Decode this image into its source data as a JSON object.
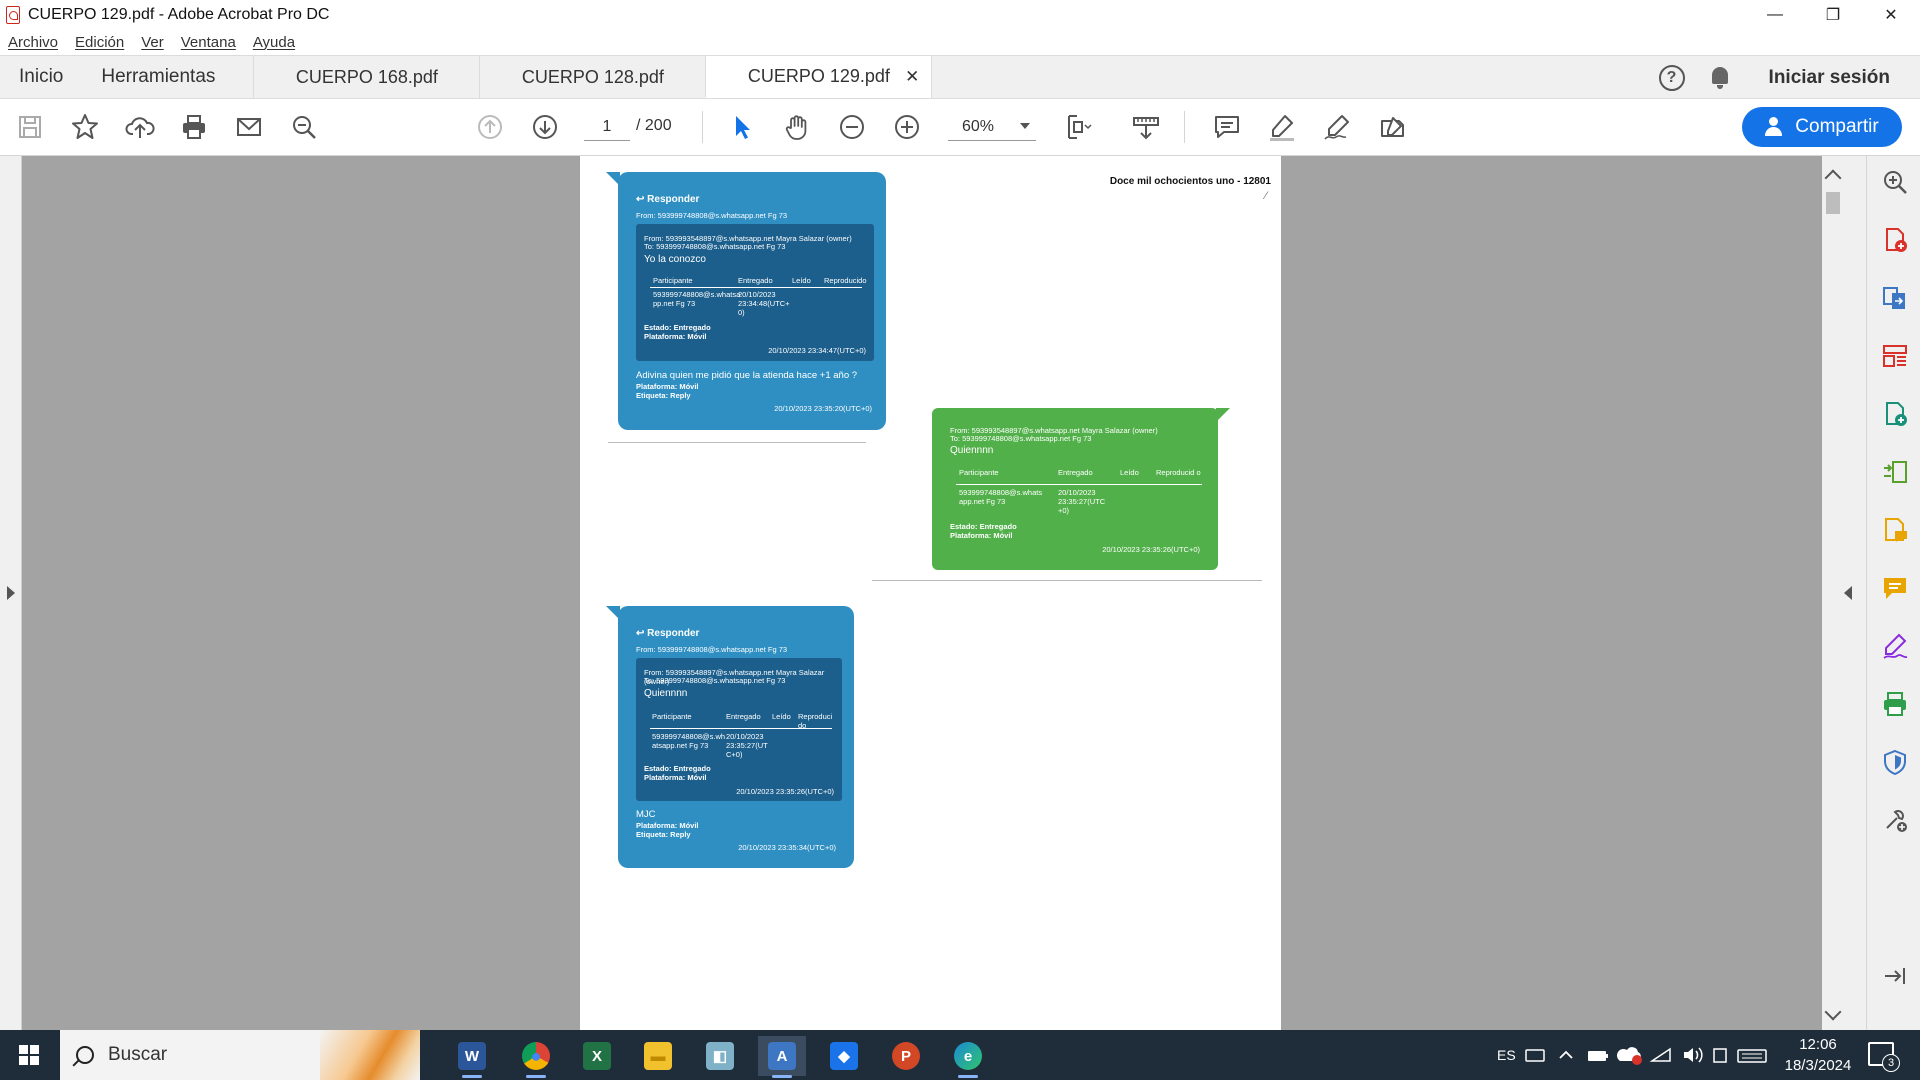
{
  "window": {
    "title": "CUERPO 129.pdf - Adobe Acrobat Pro DC",
    "minimize": "—",
    "restore": "❐",
    "close": "✕"
  },
  "menu": [
    "Archivo",
    "Edición",
    "Ver",
    "Ventana",
    "Ayuda"
  ],
  "tabs": {
    "home": "Inicio",
    "tools": "Herramientas",
    "docs": [
      "CUERPO 168.pdf",
      "CUERPO 128.pdf",
      "CUERPO 129.pdf"
    ],
    "active_doc_index": 2,
    "close_glyph": "✕",
    "help": "?",
    "signin": "Iniciar sesión"
  },
  "toolbar": {
    "page_current": "1",
    "page_total": "/ 200",
    "zoom": "60%",
    "share": "Compartir"
  },
  "document": {
    "header": "Doce mil ochocientos uno - 12801",
    "mark": "⁄",
    "messages": [
      {
        "reply_label": "Responder",
        "reply_glyph": "↩",
        "from": "From: 593999748808@s.whatsapp.net Fg 73",
        "quote_from": "From: 593993548897@s.whatsapp.net Mayra Salazar (owner)",
        "quote_to": "To: 593999748808@s.whatsapp.net Fg 73",
        "quote_msg": "Yo la conozco",
        "table_head": [
          "Participante",
          "Entregado",
          "Leído",
          "Reproducido"
        ],
        "table_row": [
          "593999748808@s.whatsa pp.net Fg 73",
          "20/10/2023 23:34:48(UTC+ 0)"
        ],
        "quote_estado": "Estado: Entregado",
        "quote_plataforma": "Plataforma: Móvil",
        "quote_ts": "20/10/2023 23:34:47(UTC+0)",
        "msg": "Adivina quien me pidió que la atienda hace +1 año ?",
        "plataforma": "Plataforma: Móvil",
        "etiqueta": "Etiqueta: Reply",
        "ts": "20/10/2023 23:35:20(UTC+0)"
      },
      {
        "from": "From: 593993548897@s.whatsapp.net Mayra Salazar (owner)",
        "to": "To: 593999748808@s.whatsapp.net Fg 73",
        "msg": "Quiennnn",
        "table_head": [
          "Participante",
          "Entregado",
          "Leído",
          "Reproducid o"
        ],
        "table_row": [
          "593999748808@s.whats app.net Fg 73",
          "20/10/2023 23:35:27(UTC +0)"
        ],
        "estado": "Estado: Entregado",
        "plataforma": "Plataforma: Móvil",
        "ts": "20/10/2023 23:35:26(UTC+0)"
      },
      {
        "reply_label": "Responder",
        "reply_glyph": "↩",
        "from": "From: 593999748808@s.whatsapp.net Fg 73",
        "quote_from": "From: 593993548897@s.whatsapp.net Mayra Salazar (owner)",
        "quote_to": "To: 593999748808@s.whatsapp.net Fg 73",
        "quote_msg": "Quiennnn",
        "table_head": [
          "Participante",
          "Entregado",
          "Leído",
          "Reproduci do"
        ],
        "table_row": [
          "593999748808@s.wh atsapp.net Fg 73",
          "20/10/2023 23:35:27(UT C+0)"
        ],
        "quote_estado": "Estado: Entregado",
        "quote_plataforma": "Plataforma: Móvil",
        "quote_ts": "20/10/2023 23:35:26(UTC+0)",
        "msg": "MJC",
        "plataforma": "Plataforma: Móvil",
        "etiqueta": "Etiqueta: Reply",
        "ts": "20/10/2023 23:35:34(UTC+0)"
      }
    ]
  },
  "taskbar": {
    "search": "Buscar",
    "lang": "ES",
    "time": "12:06",
    "date": "18/3/2024",
    "notifications": "3",
    "apps": [
      {
        "name": "word",
        "glyph": "W",
        "color": "#2b579a"
      },
      {
        "name": "chrome",
        "glyph": "●",
        "color": "#db4437"
      },
      {
        "name": "excel",
        "glyph": "X",
        "color": "#217346"
      },
      {
        "name": "file-explorer",
        "glyph": "▬",
        "color": "#f2c12e"
      },
      {
        "name": "notes",
        "glyph": "◧",
        "color": "#7fb2c9"
      },
      {
        "name": "acrobat",
        "glyph": "A",
        "color": "#3d77c4"
      },
      {
        "name": "defender",
        "glyph": "◆",
        "color": "#1a73e8"
      },
      {
        "name": "powerpoint",
        "glyph": "P",
        "color": "#d24726"
      },
      {
        "name": "edge",
        "glyph": "e",
        "color": "#1c8ad6"
      }
    ]
  }
}
